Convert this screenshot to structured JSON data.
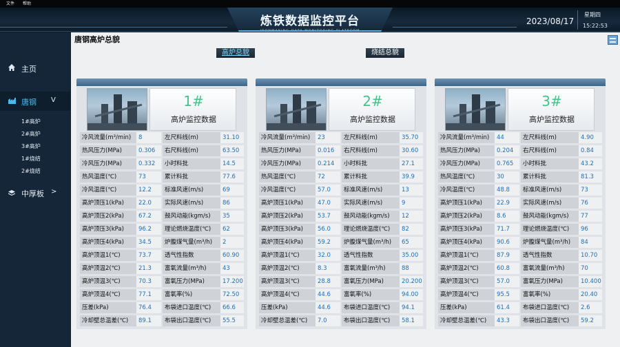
{
  "menu": {
    "file": "文件",
    "help": "帮助"
  },
  "header": {
    "title": "炼铁数据监控平台",
    "subtitle": "IRONMAKING DATA MONITORING PLATFORM",
    "date": "2023/08/17",
    "weekday": "星期四",
    "time": "15:22:53"
  },
  "sidebar": {
    "home": {
      "label": "主页",
      "icon": "home-icon"
    },
    "group": {
      "label": "唐钢",
      "icon": "factory-icon",
      "chevron": "V"
    },
    "sub_items": [
      "1#高炉",
      "2#高炉",
      "3#高炉",
      "1#烧结",
      "2#烧结"
    ],
    "mid": {
      "label": "中厚板",
      "icon": "layers-icon",
      "chevron": ">"
    }
  },
  "main": {
    "page_title": "唐钢高炉总貌",
    "tabs": [
      {
        "label": "高炉总貌",
        "active": true
      },
      {
        "label": "烧结总貌",
        "active": false
      }
    ]
  },
  "panels": [
    {
      "number": "1#",
      "subtitle": "高炉监控数据",
      "rows": [
        [
          "冷风流量(m³/min)",
          "8",
          "左尺料线(m)",
          "31.10"
        ],
        [
          "热风压力(MPa)",
          "0.306",
          "右尺料线(m)",
          "63.50"
        ],
        [
          "冷风压力(MPa)",
          "0.332",
          "小时料批",
          "14.5"
        ],
        [
          "热风温度(℃)",
          "73",
          "累计料批",
          "77.6"
        ],
        [
          "冷风温度(℃)",
          "12.2",
          "标准风速(m/s)",
          "69"
        ],
        [
          "高炉顶压1(kPa)",
          "22.0",
          "实际风速(m/s)",
          "86"
        ],
        [
          "高炉顶压2(kPa)",
          "67.2",
          "鼓风动能(kgm/s)",
          "35"
        ],
        [
          "高炉顶压3(kPa)",
          "96.2",
          "理论燃烧温度(℃)",
          "62"
        ],
        [
          "高炉顶压4(kPa)",
          "34.5",
          "炉腹煤气量(m³/h)",
          "2"
        ],
        [
          "高炉顶温1(℃)",
          "73.7",
          "透气性指数",
          "60.90"
        ],
        [
          "高炉顶温2(℃)",
          "21.3",
          "富氧流量(m³/h)",
          "43"
        ],
        [
          "高炉顶温3(℃)",
          "70.3",
          "富氧压力(MPa)",
          "17.200"
        ],
        [
          "高炉顶温4(℃)",
          "77.1",
          "富氧率(%)",
          "72.50"
        ],
        [
          "压差(kPa)",
          "76.4",
          "布袋进口温度(℃)",
          "66.6"
        ],
        [
          "冷却壁总温差(℃)",
          "89.1",
          "布袋出口温度(℃)",
          "55.5"
        ]
      ]
    },
    {
      "number": "2#",
      "subtitle": "高炉监控数据",
      "rows": [
        [
          "冷风流量(m³/min)",
          "23",
          "左尺料线(m)",
          "35.70"
        ],
        [
          "热风压力(MPa)",
          "0.016",
          "右尺料线(m)",
          "30.60"
        ],
        [
          "冷风压力(MPa)",
          "0.214",
          "小时料批",
          "27.1"
        ],
        [
          "热风温度(℃)",
          "72",
          "累计料批",
          "39.9"
        ],
        [
          "冷风温度(℃)",
          "57.0",
          "标准风速(m/s)",
          "13"
        ],
        [
          "高炉顶压1(kPa)",
          "47.0",
          "实际风速(m/s)",
          "9"
        ],
        [
          "高炉顶压2(kPa)",
          "53.7",
          "鼓风动能(kgm/s)",
          "12"
        ],
        [
          "高炉顶压3(kPa)",
          "56.0",
          "理论燃烧温度(℃)",
          "82"
        ],
        [
          "高炉顶压4(kPa)",
          "59.2",
          "炉腹煤气量(m³/h)",
          "65"
        ],
        [
          "高炉顶温1(℃)",
          "32.0",
          "透气性指数",
          "35.00"
        ],
        [
          "高炉顶温2(℃)",
          "8.3",
          "富氧流量(m³/h)",
          "88"
        ],
        [
          "高炉顶温3(℃)",
          "28.8",
          "富氧压力(MPa)",
          "20.200"
        ],
        [
          "高炉顶温4(℃)",
          "44.6",
          "富氧率(%)",
          "94.00"
        ],
        [
          "压差(kPa)",
          "44.6",
          "布袋进口温度(℃)",
          "94.1"
        ],
        [
          "冷却壁总温差(℃)",
          "7.0",
          "布袋出口温度(℃)",
          "58.1"
        ]
      ]
    },
    {
      "number": "3#",
      "subtitle": "高炉监控数据",
      "rows": [
        [
          "冷风流量(m³/min)",
          "44",
          "左尺料线(m)",
          "4.90"
        ],
        [
          "热风压力(MPa)",
          "0.204",
          "右尺料线(m)",
          "0.84"
        ],
        [
          "冷风压力(MPa)",
          "0.765",
          "小时料批",
          "43.2"
        ],
        [
          "热风温度(℃)",
          "30",
          "累计料批",
          "81.3"
        ],
        [
          "冷风温度(℃)",
          "48.8",
          "标准风速(m/s)",
          "73"
        ],
        [
          "高炉顶压1(kPa)",
          "22.9",
          "实际风速(m/s)",
          "76"
        ],
        [
          "高炉顶压2(kPa)",
          "8.6",
          "鼓风动能(kgm/s)",
          "77"
        ],
        [
          "高炉顶压3(kPa)",
          "71.7",
          "理论燃烧温度(℃)",
          "96"
        ],
        [
          "高炉顶压4(kPa)",
          "90.6",
          "炉腹煤气量(m³/h)",
          "84"
        ],
        [
          "高炉顶温1(℃)",
          "87.9",
          "透气性指数",
          "10.70"
        ],
        [
          "高炉顶温2(℃)",
          "60.8",
          "富氧流量(m³/h)",
          "70"
        ],
        [
          "高炉顶温3(℃)",
          "57.0",
          "富氧压力(MPa)",
          "10.400"
        ],
        [
          "高炉顶温4(℃)",
          "95.5",
          "富氧率(%)",
          "20.40"
        ],
        [
          "压差(kPa)",
          "61.4",
          "布袋进口温度(℃)",
          "2.6"
        ],
        [
          "冷却壁总温差(℃)",
          "43.3",
          "布袋出口温度(℃)",
          "59.2"
        ]
      ]
    }
  ]
}
